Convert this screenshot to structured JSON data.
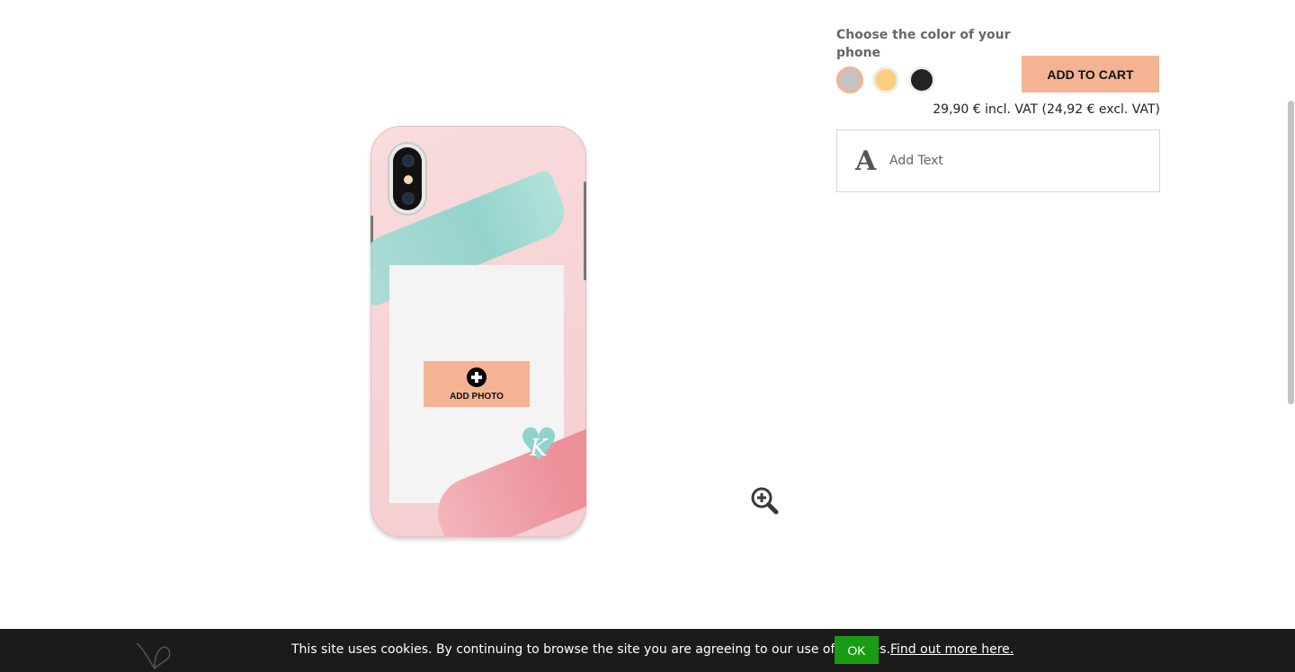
{
  "color_picker": {
    "heading": "Choose the color of your phone",
    "options": [
      {
        "name": "silver",
        "color": "#c3c3c3",
        "selected": true
      },
      {
        "name": "gold",
        "color": "#fdd07e",
        "selected": false
      },
      {
        "name": "black",
        "color": "#232323",
        "selected": false
      }
    ]
  },
  "cart": {
    "add_to_cart_label": "ADD TO CART",
    "price": "29,90 € incl. VAT (24,92 € excl. VAT)"
  },
  "editor": {
    "add_text_label": "Add Text",
    "add_text_icon": "A",
    "add_photo_label": "ADD PHOTO",
    "monogram": "K"
  },
  "cookie_bar": {
    "message": "This site uses cookies. By continuing to browse the site you are agreeing to our use of cookies.",
    "ok_label": "OK",
    "more_label": "Find out more here."
  },
  "colors": {
    "accent": "#f4b392",
    "cookie_bg": "#1b1b1b",
    "ok_green": "#1a9b14"
  },
  "icons": [
    "plus-circle-icon",
    "zoom-in-icon",
    "text-icon"
  ]
}
